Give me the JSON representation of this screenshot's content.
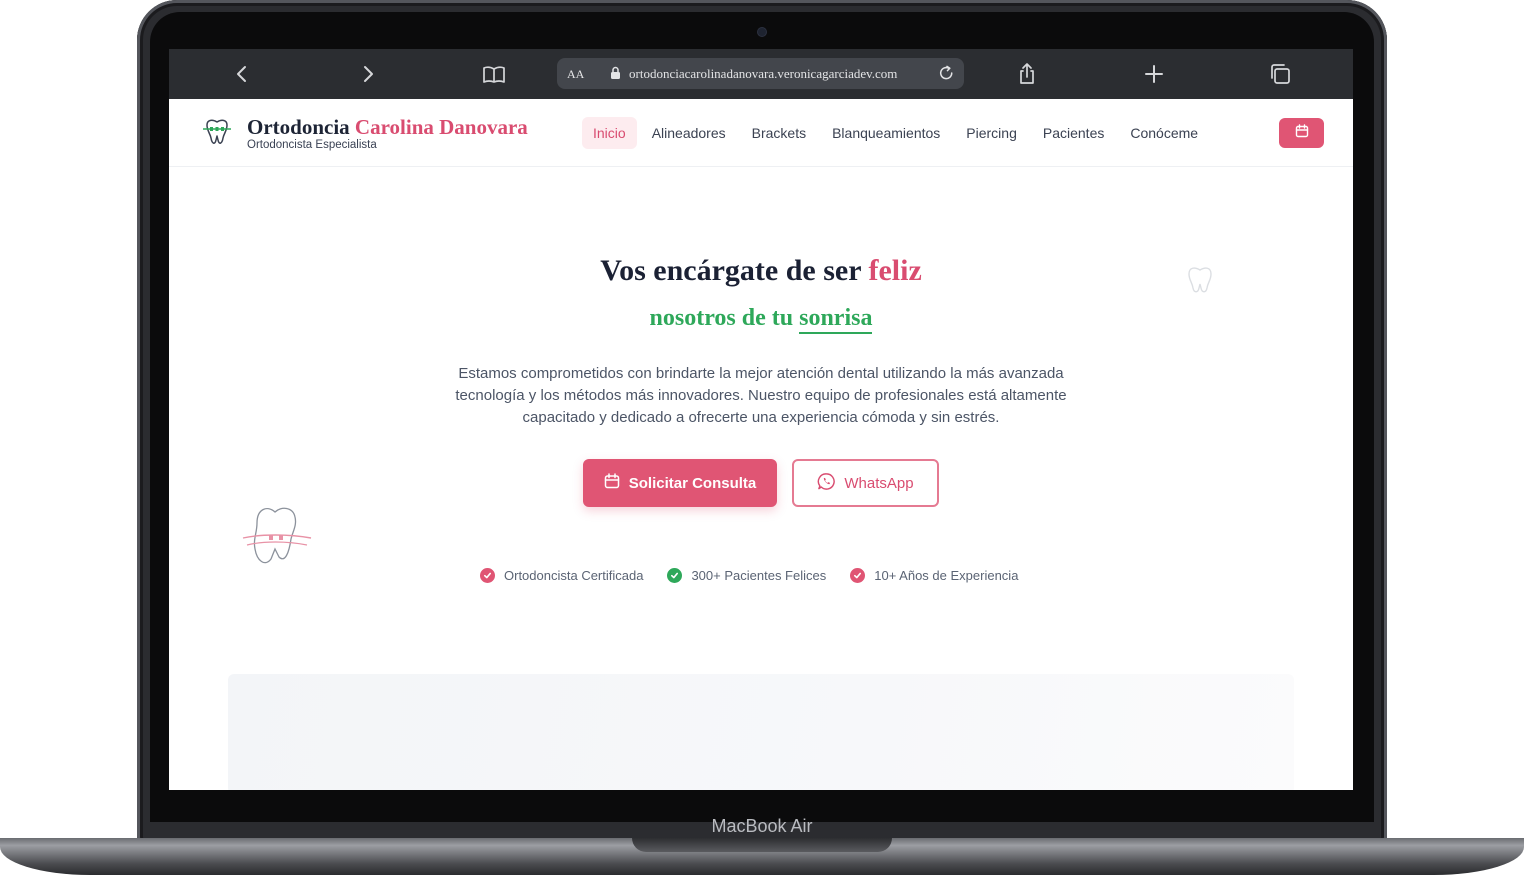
{
  "device": {
    "label": "MacBook Air"
  },
  "browser": {
    "url": "ortodonciacarolinadanovara.veronicagarciadev.com",
    "text_size_label": "AA"
  },
  "brand": {
    "name_main": "Ortodoncia ",
    "name_accent": "Carolina Danovara",
    "subtitle": "Ortodoncista Especialista"
  },
  "nav": {
    "items": [
      {
        "label": "Inicio",
        "active": true
      },
      {
        "label": "Alineadores"
      },
      {
        "label": "Brackets"
      },
      {
        "label": "Blanqueamientos"
      },
      {
        "label": "Piercing"
      },
      {
        "label": "Pacientes"
      },
      {
        "label": "Conóceme"
      }
    ],
    "calendar_icon": "calendar-icon"
  },
  "hero": {
    "title_main": "Vos encárgate de ser ",
    "title_accent": "feliz",
    "subtitle_main": "nosotros de tu ",
    "subtitle_accent": "sonrisa",
    "description": "Estamos comprometidos con brindarte la mejor atención dental utilizando la más avanzada tecnología y los métodos más innovadores. Nuestro equipo de profesionales está altamente capacitado y dedicado a ofrecerte una experiencia cómoda y sin estrés.",
    "primary_button": "Solicitar Consulta",
    "secondary_button": "WhatsApp"
  },
  "features": [
    {
      "label": "Ortodoncista Certificada",
      "color": "#e05574"
    },
    {
      "label": "300+ Pacientes Felices",
      "color": "#2ea85a"
    },
    {
      "label": "10+ Años de Experiencia",
      "color": "#e05574"
    }
  ],
  "colors": {
    "accent": "#d94c70",
    "green": "#2ea85a",
    "heading": "#1b2134",
    "toolbar": "#2b2d31"
  }
}
